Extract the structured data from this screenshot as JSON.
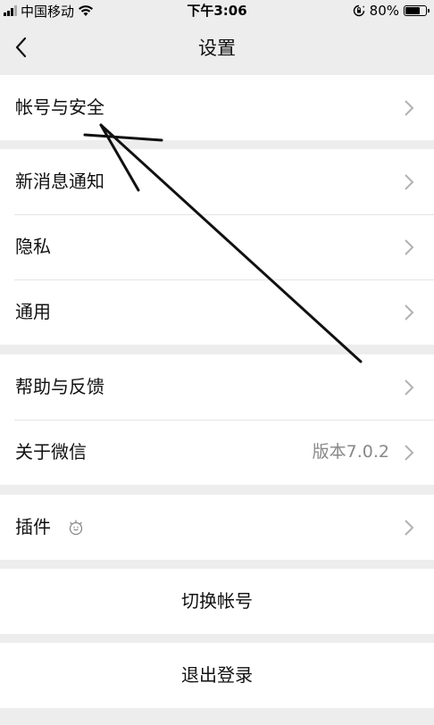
{
  "status_bar": {
    "carrier": "中国移动",
    "time": "下午3:06",
    "battery_text": "80%",
    "battery_level": 0.8,
    "signal_icon": "signal-icon",
    "wifi_icon": "wifi-icon",
    "orientation_lock_icon": "orientation-lock-icon"
  },
  "nav": {
    "title": "设置",
    "back_icon": "chevron-left-icon"
  },
  "groups": [
    {
      "items": [
        {
          "label": "帐号与安全"
        }
      ]
    },
    {
      "items": [
        {
          "label": "新消息通知"
        },
        {
          "label": "隐私"
        },
        {
          "label": "通用"
        }
      ]
    },
    {
      "items": [
        {
          "label": "帮助与反馈"
        },
        {
          "label": "关于微信",
          "value": "版本7.0.2"
        }
      ]
    },
    {
      "items": [
        {
          "label": "插件",
          "icon": "plugin-icon"
        }
      ]
    }
  ],
  "actions": {
    "switch_account": "切换帐号",
    "logout": "退出登录"
  },
  "colors": {
    "background": "#ededed",
    "card": "#ffffff",
    "divider": "#e5e5e5",
    "secondary_text": "#888888",
    "chevron": "#b2b2b2"
  }
}
